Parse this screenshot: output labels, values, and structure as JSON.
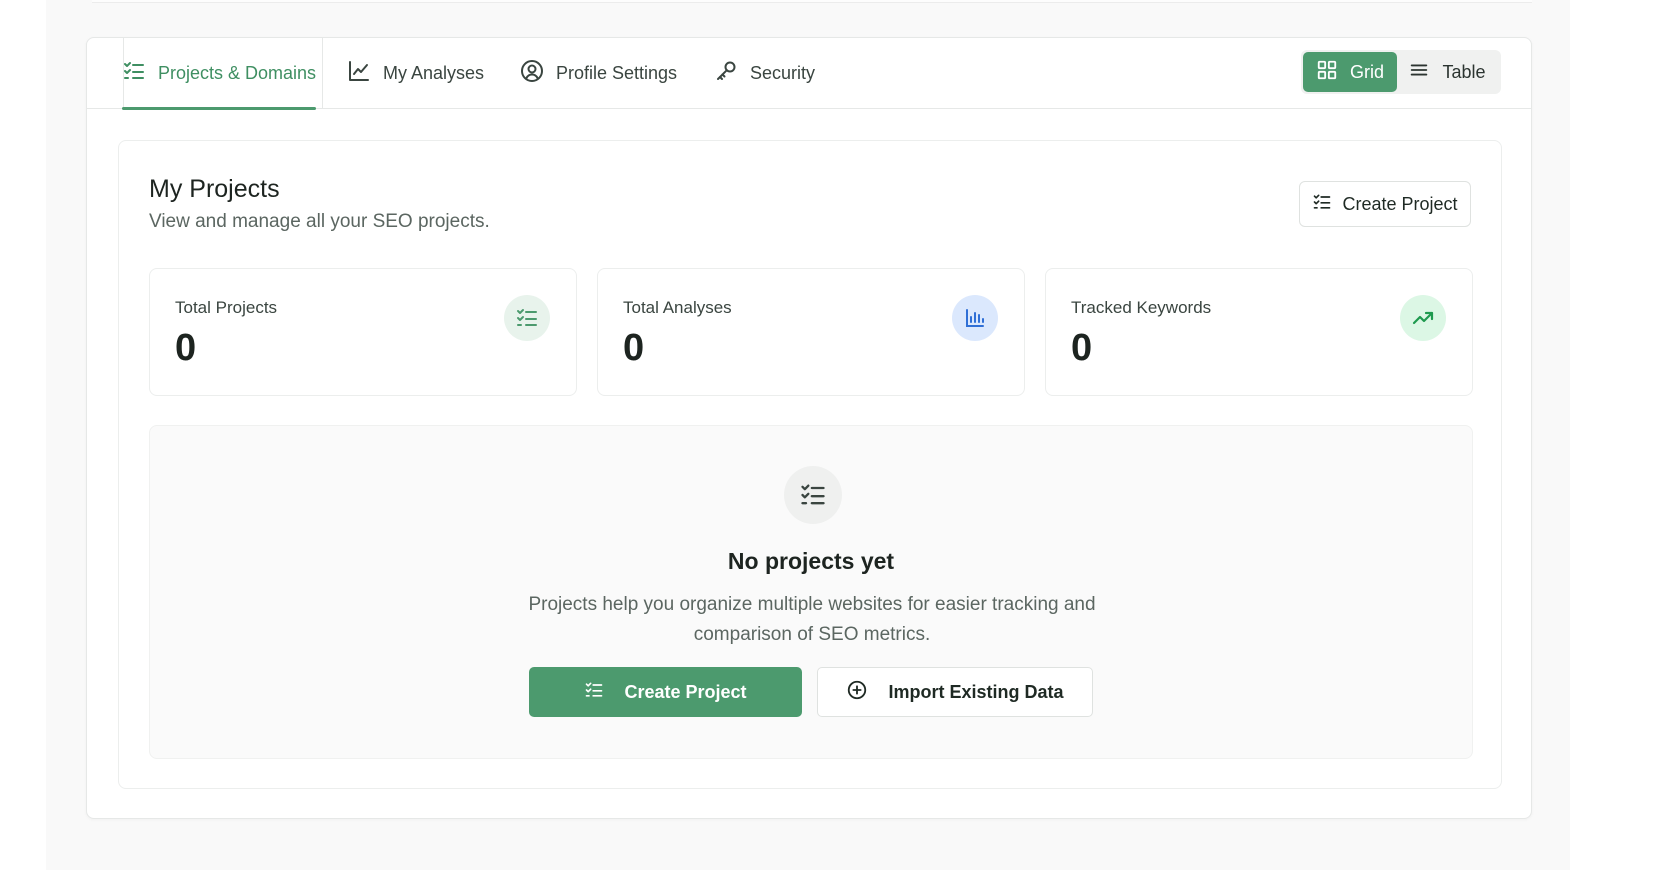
{
  "tabs": [
    {
      "label": "Projects & Domains",
      "icon": "list-check-icon",
      "active": true
    },
    {
      "label": "My Analyses",
      "icon": "line-chart-icon",
      "active": false
    },
    {
      "label": "Profile Settings",
      "icon": "user-circle-icon",
      "active": false
    },
    {
      "label": "Security",
      "icon": "key-icon",
      "active": false
    }
  ],
  "view_toggle": {
    "grid_label": "Grid",
    "table_label": "Table",
    "selected": "Grid"
  },
  "projects": {
    "title": "My Projects",
    "subtitle": "View and manage all your SEO projects.",
    "create_button_label": "Create Project"
  },
  "stats": [
    {
      "label": "Total Projects",
      "value": "0",
      "icon": "list-check-icon",
      "icon_bg": "#e8f3ec",
      "icon_color": "#4c9a6e"
    },
    {
      "label": "Total Analyses",
      "value": "0",
      "icon": "bar-chart-icon",
      "icon_bg": "#dbe8fd",
      "icon_color": "#2f6fd6"
    },
    {
      "label": "Tracked Keywords",
      "value": "0",
      "icon": "trending-up-icon",
      "icon_bg": "#dcf7e5",
      "icon_color": "#1f9a4f"
    }
  ],
  "empty_state": {
    "title": "No projects yet",
    "description": "Projects help you organize multiple websites for easier tracking and comparison of SEO metrics.",
    "primary_button": "Create Project",
    "secondary_button": "Import Existing Data"
  },
  "colors": {
    "accent": "#4c9a6e",
    "active_tab_text": "#3f8f62",
    "text_primary": "#1d2420",
    "text_muted": "#5b6661"
  }
}
